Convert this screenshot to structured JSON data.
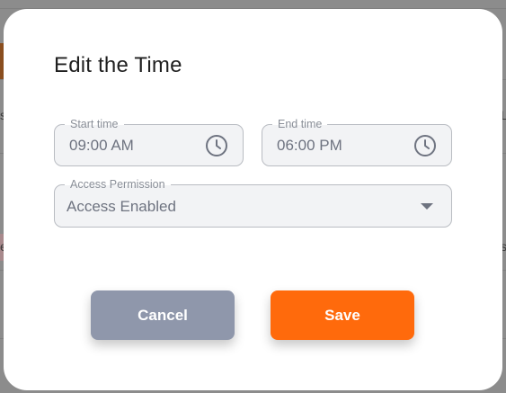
{
  "background_fragments": {
    "left_s": "s",
    "left_e": "e",
    "right_l": "L",
    "right_s": "s"
  },
  "dialog": {
    "title": "Edit the Time",
    "start_time": {
      "legend": "Start time",
      "value": "09:00 AM",
      "icon": "clock-icon"
    },
    "end_time": {
      "legend": "End time",
      "value": "06:00 PM",
      "icon": "clock-icon"
    },
    "access_permission": {
      "legend": "Access Permission",
      "value": "Access Enabled",
      "icon": "caret-down-icon"
    },
    "cancel_label": "Cancel",
    "save_label": "Save"
  },
  "colors": {
    "save": "#ff6a0c",
    "cancel": "#8f97ab",
    "field_bg": "#f2f3f5",
    "overlay": "#8c8c8c"
  }
}
